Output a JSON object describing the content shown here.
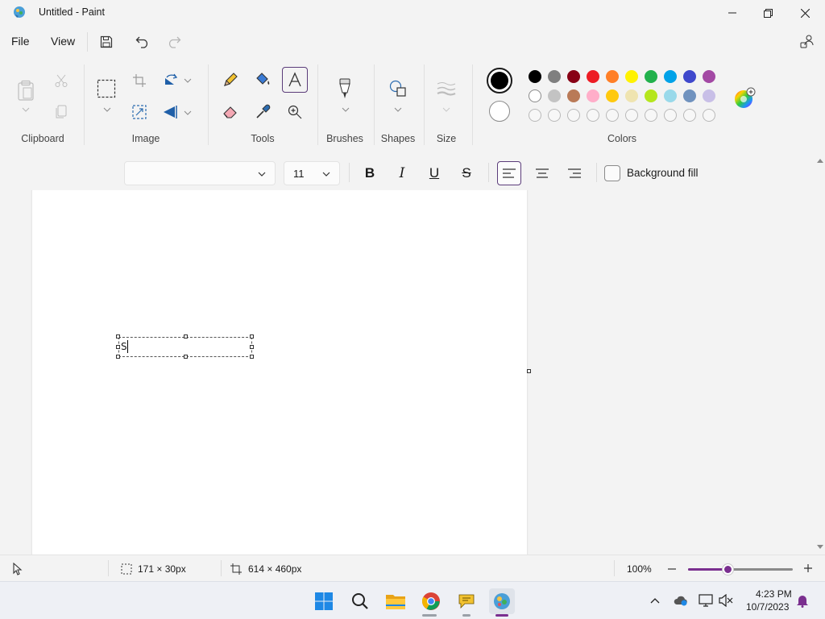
{
  "window": {
    "title": "Untitled - Paint"
  },
  "menu": {
    "file": "File",
    "view": "View"
  },
  "ribbon": {
    "groups": {
      "clipboard": "Clipboard",
      "image": "Image",
      "tools": "Tools",
      "brushes": "Brushes",
      "shapes": "Shapes",
      "size": "Size",
      "colors": "Colors"
    },
    "active_tool": "text-tool",
    "primary_color": "#000000",
    "secondary_color": "#ffffff",
    "palette_rows": [
      [
        "#000000",
        "#7f7f7f",
        "#880015",
        "#ed1c24",
        "#ff7f27",
        "#fff200",
        "#22b14c",
        "#00a2e8",
        "#3f48cc",
        "#a349a4"
      ],
      [
        "#ffffff",
        "#c3c3c3",
        "#b97a57",
        "#ffaec9",
        "#ffc90e",
        "#efe4b0",
        "#b5e61d",
        "#99d9ea",
        "#7092be",
        "#c8bfe7"
      ],
      [
        "",
        "",
        "",
        "",
        "",
        "",
        "",
        "",
        "",
        ""
      ]
    ]
  },
  "text_toolbar": {
    "font_family": "",
    "font_size": "11",
    "bold": "B",
    "italic": "I",
    "underline": "U",
    "strikethrough": "S",
    "alignment": "left",
    "background_fill_label": "Background fill",
    "background_fill_checked": false
  },
  "canvas": {
    "text_content": "S"
  },
  "status": {
    "selection_size": "171 × 30px",
    "canvas_size": "614 × 460px",
    "zoom_label": "100%",
    "zoom_fraction": 0.38
  },
  "taskbar": {
    "time": "4:23 PM",
    "date": "10/7/2023"
  }
}
